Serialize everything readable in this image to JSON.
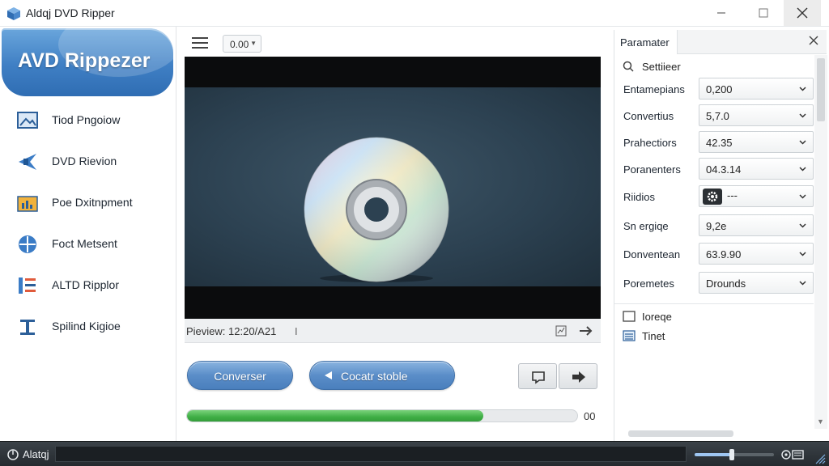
{
  "window": {
    "title": "Aldqj DVD Ripper",
    "minimize_icon": "minimize-icon",
    "maximize_icon": "maximize-icon",
    "close_icon": "close-icon"
  },
  "sidebar": {
    "brand": "AVD Rippezer",
    "items": [
      {
        "label": "Tiod Pngoiow",
        "icon": "image-icon"
      },
      {
        "label": "DVD Rievion",
        "icon": "star-icon"
      },
      {
        "label": "Poe Dxitnpment",
        "icon": "folder-chart-icon"
      },
      {
        "label": "Foct Metsent",
        "icon": "crosshair-icon"
      },
      {
        "label": "ALTD Ripplor",
        "icon": "list-icon"
      },
      {
        "label": "Spilind Kigioe",
        "icon": "text-cursor-icon"
      }
    ]
  },
  "toolbar": {
    "menu_icon": "hamburger-icon",
    "zoom_value": "0.00"
  },
  "player": {
    "preview_text": "Pieview: 12:20/A21",
    "preview_cursor": "I",
    "chart_icon": "chart-icon",
    "next_icon": "arrow-right-icon"
  },
  "actions": {
    "convert_label": "Converser",
    "stop_label": "Cocatr stoble",
    "stop_icon": "back-arrow-icon",
    "btn1_icon": "window-icon",
    "btn2_icon": "forward-icon"
  },
  "progress": {
    "fraction": 0.76,
    "value_text": "00"
  },
  "panel": {
    "tab": "Paramater",
    "close_icon": "close-icon",
    "search_label": "Settiieer",
    "rows": [
      {
        "label": "Entamepians",
        "value": "0,200"
      },
      {
        "label": "Convertius",
        "value": "5,7.0"
      },
      {
        "label": "Prahectiors",
        "value": "42.35"
      },
      {
        "label": "Poranenters",
        "value": "04.3.14"
      },
      {
        "label": "Riidios",
        "value": "---",
        "icon": "gear-icon"
      },
      {
        "label": "Sn ergiqe",
        "value": "9,2e"
      },
      {
        "label": "Donventean",
        "value": "63.9.90"
      },
      {
        "label": "Poremetes",
        "value": "Drounds"
      }
    ],
    "options": [
      {
        "label": "Ioreqe",
        "icon": "checkbox-icon"
      },
      {
        "label": "Tinet",
        "icon": "list-icon"
      }
    ]
  },
  "statusbar": {
    "label": "Alatqj",
    "volume_fraction": 0.47
  }
}
